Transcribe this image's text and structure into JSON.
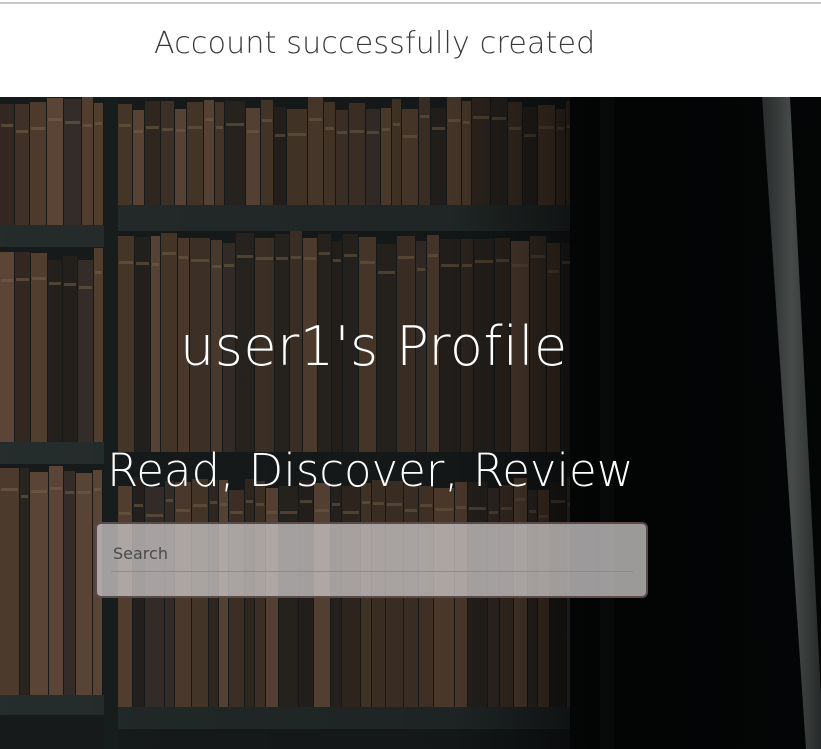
{
  "notification": {
    "message": "Account successfully created"
  },
  "hero": {
    "title": "user1's Profile",
    "subtitle": "Read, Discover, Review",
    "background": "library-bookshelf"
  },
  "search": {
    "placeholder": "Search",
    "value": ""
  },
  "colors": {
    "banner_bg": "#ffffff",
    "banner_text": "#3a3a3a",
    "hero_text": "#ffffff",
    "search_border": "#5b4a4a"
  }
}
